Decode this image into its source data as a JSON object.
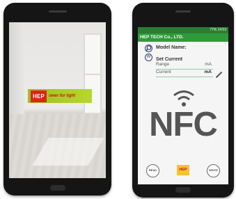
{
  "left_phone": {
    "logo": {
      "brand": "HEP",
      "tagline": "ower for light"
    }
  },
  "right_phone": {
    "status_text": "77% 14:53",
    "header_title": "HEP TECH Co., LTD.",
    "model_label": "Model Name:",
    "set_current_label": "Set Current",
    "range_label": "Range",
    "range_unit": "mA",
    "current_label": "Current",
    "current_unit": "mA",
    "nfc_label": "NFC",
    "read_button": "READ",
    "write_button": "WRITE",
    "hep_badge": "HEP"
  },
  "colors": {
    "header_green": "#2f9a3a",
    "status_green": "#2a7d34",
    "logo_green": "#9cc11f",
    "logo_red": "#e3201b"
  }
}
